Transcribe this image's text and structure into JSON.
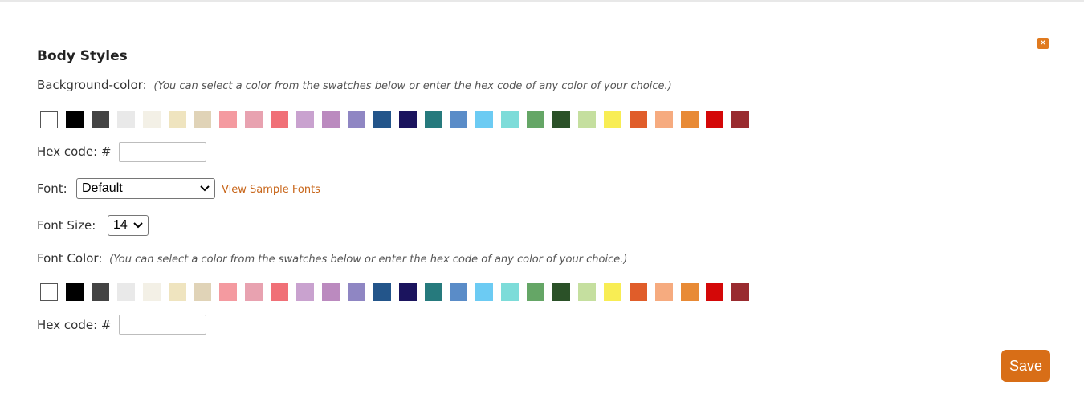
{
  "dialog": {
    "title": "Body Styles",
    "close_label": "×",
    "save_label": "Save"
  },
  "background": {
    "label": "Background-color:",
    "hint": "(You can select a color from the swatches below or enter the hex code of any color of your choice.)",
    "hex_label": "Hex code:",
    "hex_prefix": "#",
    "hex_value": ""
  },
  "font": {
    "label": "Font:",
    "selected": "Default",
    "sample_link": "View Sample Fonts"
  },
  "font_size": {
    "label": "Font Size:",
    "selected": "14"
  },
  "font_color": {
    "label": "Font Color:",
    "hint": "(You can select a color from the swatches below or enter the hex code of any color of your choice.)",
    "hex_label": "Hex code:",
    "hex_prefix": "#",
    "hex_value": ""
  },
  "swatch_colors": [
    "#ffffff",
    "#000000",
    "#444444",
    "#e9e9e9",
    "#f3f0e6",
    "#efe4bf",
    "#e0d3b7",
    "#f49aa0",
    "#e8a2b0",
    "#f07077",
    "#c9a2cf",
    "#bb8abf",
    "#8f86c3",
    "#23558a",
    "#1b145e",
    "#267a7d",
    "#5a8cc8",
    "#6ccbf3",
    "#7ddcd9",
    "#65a666",
    "#2b5128",
    "#c5df9f",
    "#f8ed54",
    "#e05d2a",
    "#f6ab7f",
    "#e88a35",
    "#d40808",
    "#992b2f"
  ]
}
